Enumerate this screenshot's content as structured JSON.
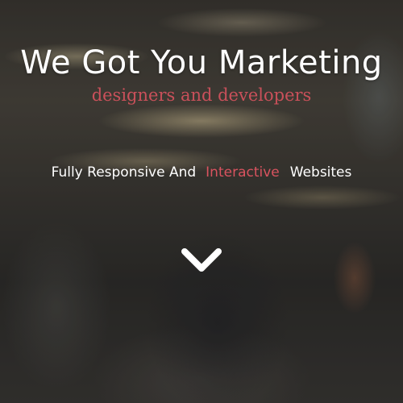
{
  "hero": {
    "title": "We Got You Marketing",
    "subtitle": "designers and developers",
    "tagline": {
      "part1": "Fully Responsive And",
      "highlight": "Interactive",
      "part2": "Websites"
    },
    "scroll_icon": "chevron-down-icon"
  },
  "colors": {
    "text": "#ffffff",
    "accent": "#d9535f"
  }
}
